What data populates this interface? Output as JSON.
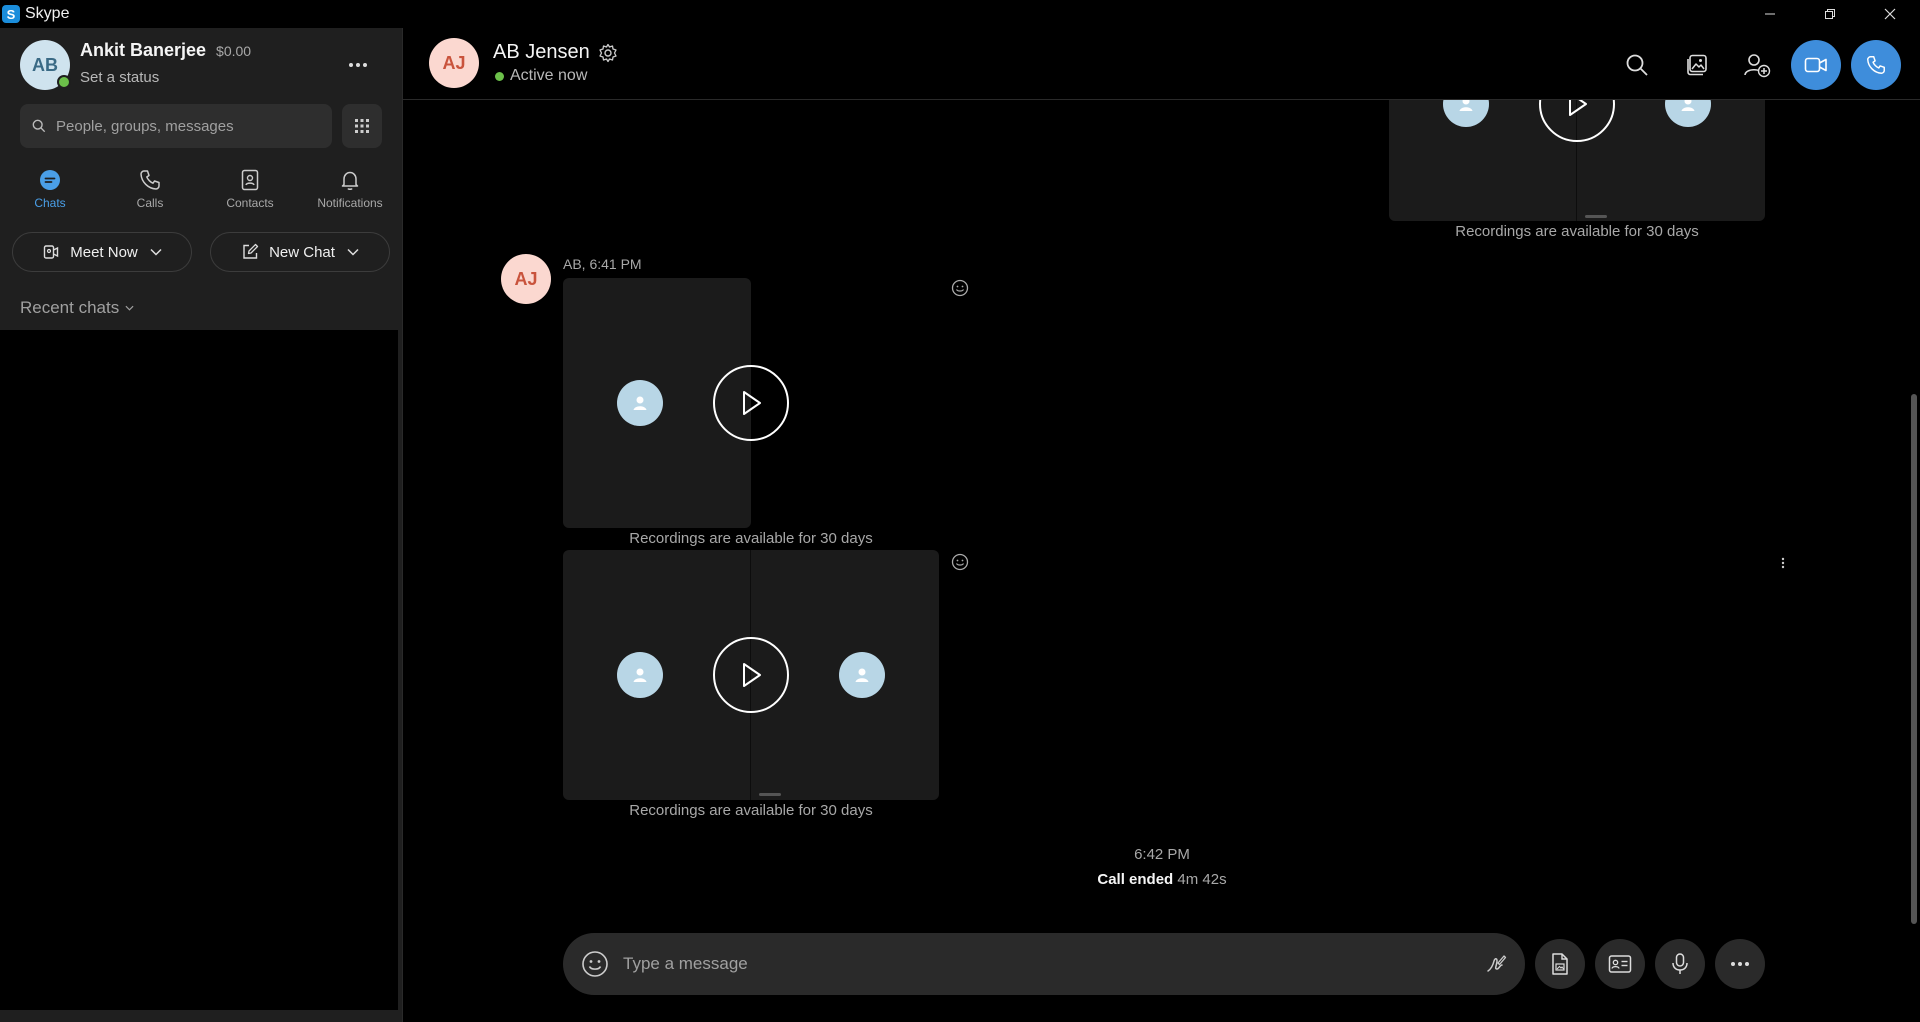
{
  "window": {
    "title": "Skype",
    "logo_letter": "S"
  },
  "profile": {
    "initials": "AB",
    "name": "Ankit Banerjee",
    "credit": "$0.00",
    "status": "Set a status"
  },
  "search": {
    "placeholder": "People, groups, messages"
  },
  "nav": {
    "chats": "Chats",
    "calls": "Calls",
    "contacts": "Contacts",
    "notifications": "Notifications"
  },
  "actions": {
    "meet_now": "Meet Now",
    "new_chat": "New Chat"
  },
  "recent": {
    "header": "Recent chats"
  },
  "chat": {
    "contact_initials": "AJ",
    "contact_name": "AB Jensen",
    "contact_status": "Active now",
    "message_meta": "AB, 6:41 PM",
    "recording_note_top": "Recordings are available for 30 days",
    "recording_note_1": "Recordings are available for 30 days",
    "recording_note_2": "Recordings are available for 30 days",
    "call_time": "6:42 PM",
    "call_ended_label": "Call ended",
    "call_duration": "4m 42s"
  },
  "composer": {
    "placeholder": "Type a message"
  },
  "colors": {
    "accent": "#3e8ddb",
    "presence": "#6cc04a"
  }
}
